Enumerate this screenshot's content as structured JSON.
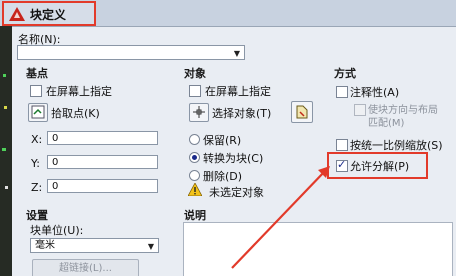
{
  "window": {
    "title": "块定义"
  },
  "name_section": {
    "label": "名称",
    "mnemonic": "(N):",
    "value": ""
  },
  "base_point": {
    "group_title": "基点",
    "specify_on_screen": "在屏幕上指定",
    "pick_point": "拾取点",
    "pick_mnemonic": "(K)",
    "x_label": "X:",
    "x_value": "0",
    "y_label": "Y:",
    "y_value": "0",
    "z_label": "Z:",
    "z_value": "0"
  },
  "objects": {
    "group_title": "对象",
    "specify_on_screen": "在屏幕上指定",
    "select_objects": "选择对象",
    "select_mnemonic": "(T)",
    "retain": "保留",
    "retain_mnemonic": "(R)",
    "convert_to_block": "转换为块",
    "convert_mnemonic": "(C)",
    "delete": "删除",
    "delete_mnemonic": "(D)",
    "warning": "未选定对象",
    "selected_radio": "convert_to_block"
  },
  "behavior": {
    "group_title": "方式",
    "annotative": "注释性",
    "annotative_mnemonic": "(A)",
    "match_orientation_line1": "使块方向与布局",
    "match_orientation_line2": "匹配",
    "match_mnemonic": "(M)",
    "scale_uniformly": "按统一比例缩放",
    "scale_mnemonic": "(S)",
    "allow_exploding": "允许分解",
    "explode_mnemonic": "(P)",
    "allow_exploding_checked": true
  },
  "settings": {
    "group_title": "设置",
    "block_unit_label": "块单位",
    "block_unit_mnemonic": "(U):",
    "block_unit_value": "毫米",
    "hyperlink_button": "超链接",
    "hyperlink_mnemonic": "(L)..."
  },
  "description": {
    "group_title": "说明",
    "value": ""
  },
  "colors": {
    "highlight_red": "#e23a2a",
    "dialog_bg": "#e9edf3"
  }
}
